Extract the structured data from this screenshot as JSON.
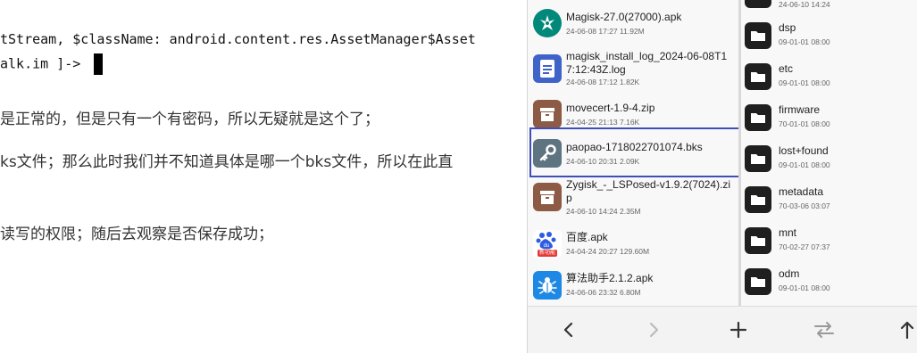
{
  "article": {
    "code_lines": [
      "tStream, $className: android.content.res.AssetManager$Asset",
      "alk.im ]-> "
    ],
    "paragraphs": [
      "是正常的，但是只有一个有密码，所以无疑就是这个了；",
      "ks文件；那么此时我们并不知道具体是哪一个bks文件，所以在此直",
      "读写的权限；随后去观察是否保存成功；"
    ]
  },
  "files": [
    {
      "name": "Magisk-27.0(27000).apk",
      "meta": "24-06-08 17:27   11.92M",
      "icon": "magisk-icon",
      "color": "#00897b"
    },
    {
      "name": "magisk_install_log_2024-06-08T17:12:43Z.log",
      "meta": "24-06-08 17:12   1.82K",
      "icon": "document-icon",
      "color": "#3f63c8"
    },
    {
      "name": "movecert-1.9-4.zip",
      "meta": "24-04-25 21:13   7.16K",
      "icon": "archive-icon",
      "color": "#8d5b45"
    },
    {
      "name": "paopao-1718022701074.bks",
      "meta": "24-06-10 20:31   2.09K",
      "icon": "key-icon",
      "color": "#5f7481"
    },
    {
      "name": "Zygisk_-_LSPosed-v1.9.2(7024).zip",
      "meta": "24-06-10 14:24   2.35M",
      "icon": "archive-icon",
      "color": "#8d5b45"
    },
    {
      "name": "百度.apk",
      "meta": "24-04-24 20:27   129.60M",
      "icon": "baidu-icon",
      "color": "#ffffff"
    },
    {
      "name": "算法助手2.1.2.apk",
      "meta": "24-06-06 23:32   6.80M",
      "icon": "bug-icon",
      "color": "#1e88e5"
    }
  ],
  "top_right_meta": "24-06-10 14:24",
  "baidu_badge": "新功能",
  "dirs": [
    {
      "name": "dsp",
      "meta": "09-01-01 08:00"
    },
    {
      "name": "etc",
      "meta": "09-01-01 08:00"
    },
    {
      "name": "firmware",
      "meta": "70-01-01 08:00"
    },
    {
      "name": "lost+found",
      "meta": "09-01-01 08:00"
    },
    {
      "name": "metadata",
      "meta": "70-03-06 03:07"
    },
    {
      "name": "mnt",
      "meta": "70-02-27 07:37"
    },
    {
      "name": "odm",
      "meta": "09-01-01 08:00"
    }
  ],
  "nav": {
    "back": "‹",
    "forward": "›",
    "add": "+",
    "swap": "⇄",
    "up": "↑"
  }
}
